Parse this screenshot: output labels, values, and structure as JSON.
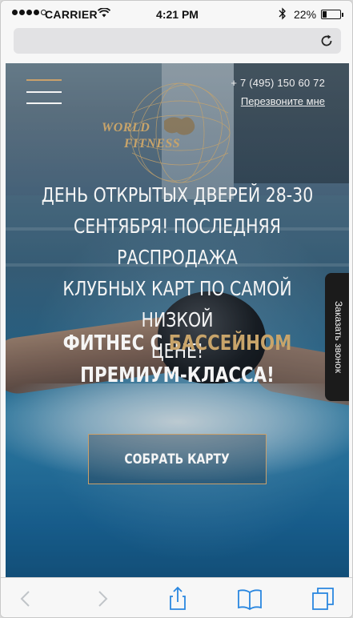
{
  "status_bar": {
    "carrier": "CARRIER",
    "time": "4:21 PM",
    "battery_percent": "22%",
    "battery_level": 0.22,
    "signal_bars_filled": 4,
    "signal_bars_total": 5
  },
  "browser": {
    "url_text": "",
    "reload_icon": "reload-icon",
    "toolbar_icons": [
      "back-arrow-icon",
      "forward-arrow-icon",
      "share-icon",
      "bookmarks-icon",
      "tabs-icon"
    ]
  },
  "site": {
    "menu_icon": "hamburger-menu-icon",
    "phone": "+ 7 (495) 150 60 72",
    "callback_link": "Перезвоните мне",
    "logo": {
      "line1": "WORLD",
      "line2": "FITNESS"
    },
    "headline_lines": [
      "ДЕНЬ ОТКРЫТЫХ ДВЕРЕЙ 28-30",
      "СЕНТЯБРЯ! ПОСЛЕДНЯЯ РАСПРОДАЖА",
      "КЛУБНЫХ КАРТ ПО САМОЙ НИЗКОЙ",
      "ЦЕНЕ!"
    ],
    "subline": {
      "part1": "ФИТНЕС С ",
      "part2": "БАССЕЙНОМ",
      "part3": "ПРЕМИУМ-КЛАССА!"
    },
    "cta_label": "СОБРАТЬ КАРТУ",
    "side_tab_label": "Заказать звонок",
    "colors": {
      "accent_gold": "#c8a46a",
      "text_light": "#f5f5f5",
      "side_tab_bg": "#1b1b1b"
    }
  }
}
